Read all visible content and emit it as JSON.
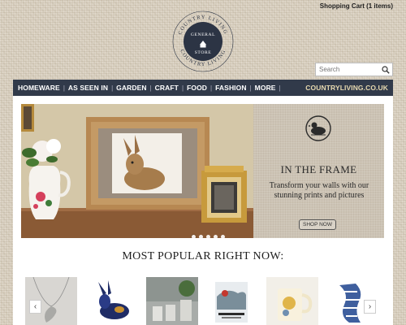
{
  "header": {
    "cart_label": "Shopping Cart (1 items)",
    "logo": {
      "top_text": "COUNTRY LIVING",
      "center_line1": "GENERAL",
      "center_line2": "STORE",
      "bottom_text": "COUNTRY LIVING"
    }
  },
  "search": {
    "placeholder": "Search",
    "icon": "search-icon"
  },
  "nav": {
    "items": [
      {
        "label": "HOMEWARE"
      },
      {
        "label": "AS SEEN IN"
      },
      {
        "label": "GARDEN"
      },
      {
        "label": "CRAFT"
      },
      {
        "label": "FOOD"
      },
      {
        "label": "FASHION"
      },
      {
        "label": "MORE"
      }
    ],
    "right_link": "COUNTRYLIVING.CO.UK"
  },
  "banner": {
    "title": "IN THE FRAME",
    "subtitle": "Transform your walls with our stunning prints and pictures",
    "button": "SHOP NOW",
    "slide_count": 5,
    "active_slide": 1
  },
  "popular": {
    "title": "MOST POPULAR RIGHT NOW:",
    "prev_icon": "chevron-left-icon",
    "next_icon": "chevron-right-icon"
  },
  "colors": {
    "nav_bg": "#313a4a",
    "nav_text": "#ffffff",
    "nav_right": "#e7d9b0",
    "background": "#d9d0c0"
  }
}
